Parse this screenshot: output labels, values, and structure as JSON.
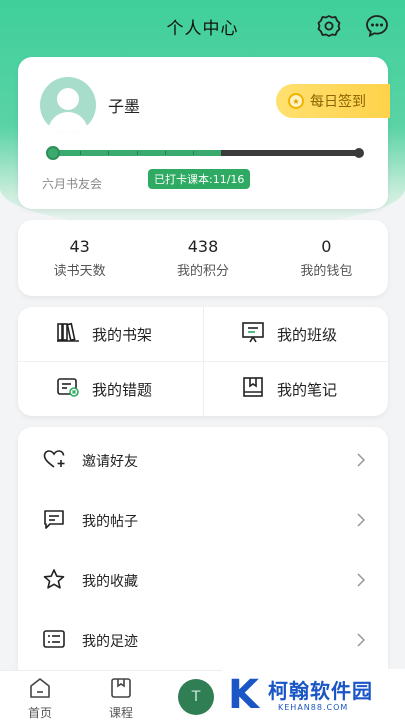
{
  "header": {
    "title": "个人中心"
  },
  "profile": {
    "username": "子墨",
    "checkin_label": "每日签到",
    "club_label": "六月书友会",
    "progress_tag": "已打卡课本:11/16",
    "progress": {
      "done": 11,
      "total": 16
    }
  },
  "stats": [
    {
      "value": "43",
      "label": "读书天数"
    },
    {
      "value": "438",
      "label": "我的积分"
    },
    {
      "value": "0",
      "label": "我的钱包"
    }
  ],
  "grid": [
    {
      "label": "我的书架",
      "icon": "bookshelf-icon"
    },
    {
      "label": "我的班级",
      "icon": "class-board-icon"
    },
    {
      "label": "我的错题",
      "icon": "wrong-question-icon"
    },
    {
      "label": "我的笔记",
      "icon": "notebook-icon"
    }
  ],
  "menu": [
    {
      "label": "邀请好友",
      "icon": "invite-heart-icon"
    },
    {
      "label": "我的帖子",
      "icon": "post-chat-icon"
    },
    {
      "label": "我的收藏",
      "icon": "star-icon"
    },
    {
      "label": "我的足迹",
      "icon": "footprint-list-icon"
    }
  ],
  "tabbar": {
    "home": "首页",
    "course": "课程"
  },
  "watermark": {
    "brand": "柯翰软件园",
    "domain": "KEHAN88.COM"
  },
  "colors": {
    "accent": "#3aaa6e",
    "checkin": "#ffd24a",
    "watermark": "#1a56c5"
  }
}
